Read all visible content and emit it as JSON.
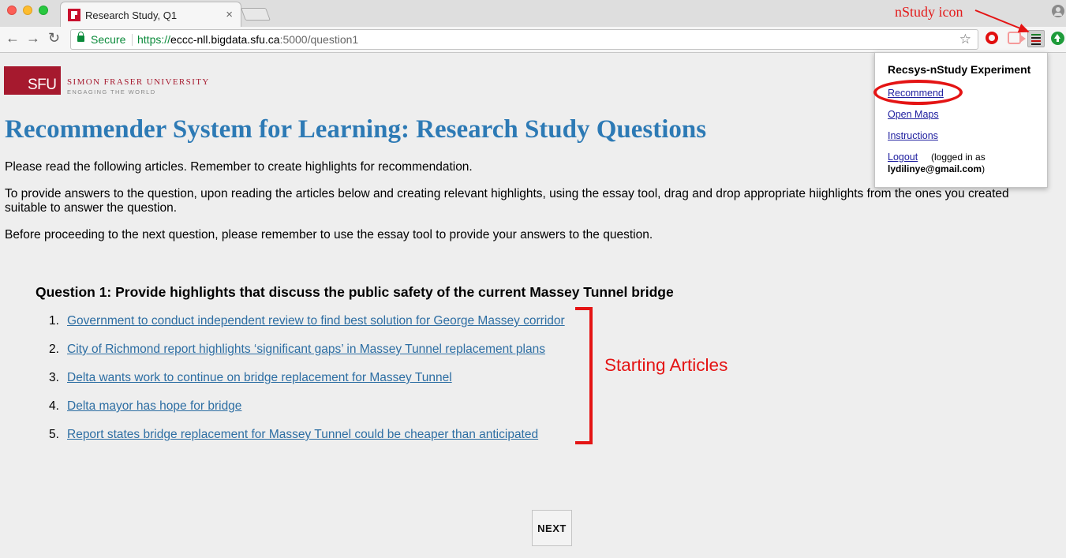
{
  "browser": {
    "tab_title": "Research Study, Q1",
    "tab_close": "×",
    "secure_label": "Secure",
    "url_scheme": "https://",
    "url_host": "eccc-nll.bigdata.sfu.ca",
    "url_path": ":5000/question1",
    "back_icon": "←",
    "forward_icon": "→",
    "reload_icon": "↻",
    "star_icon": "☆"
  },
  "annotations": {
    "nstudy_icon_label": "nStudy icon",
    "starting_articles_label": "Starting Articles",
    "color": "#e41414"
  },
  "header": {
    "logo_text": "SFU",
    "university_name": "SIMON FRASER UNIVERSITY",
    "tagline": "ENGAGING THE WORLD"
  },
  "page": {
    "title": "Recommender System for Learning: Research Study Questions",
    "intro1": "Please read the following articles. Remember to create highlights for recommendation.",
    "intro2": "To provide answers to the question, upon reading the articles below and creating relevant highlights, using the essay tool, drag and drop appropriate hiighlights from the ones you created suitable to answer the question.",
    "intro3": "Before proceeding to the next question, please remember to use the essay tool to provide your answers to the question.",
    "question": "Question 1: Provide highlights that discuss the public safety of the current Massey Tunnel bridge",
    "articles": [
      {
        "num": "1.",
        "title": "Government to conduct independent review to find best solution for George Massey corridor"
      },
      {
        "num": "2.",
        "title": "City of Richmond report highlights ‘significant gaps’ in Massey Tunnel replacement plans"
      },
      {
        "num": "3.",
        "title": "Delta wants work to continue on bridge replacement for Massey Tunnel"
      },
      {
        "num": "4.",
        "title": "Delta mayor has hope for bridge"
      },
      {
        "num": "5.",
        "title": "Report states bridge replacement for Massey Tunnel could be cheaper than anticipated"
      }
    ],
    "next_label": "NEXT"
  },
  "popup": {
    "title": "Recsys-nStudy Experiment",
    "recommend": "Recommend",
    "open_maps": "Open Maps",
    "instructions": "Instructions",
    "logout": "Logout",
    "logged_in_as": "(logged in as",
    "email": "lydilinye@gmail.com",
    "email_close": ")"
  },
  "colors": {
    "title_blue": "#2d7ab5",
    "link_blue": "#2d6ea3",
    "sfu_red": "#a6192e",
    "secure_green": "#0a8a3a"
  }
}
